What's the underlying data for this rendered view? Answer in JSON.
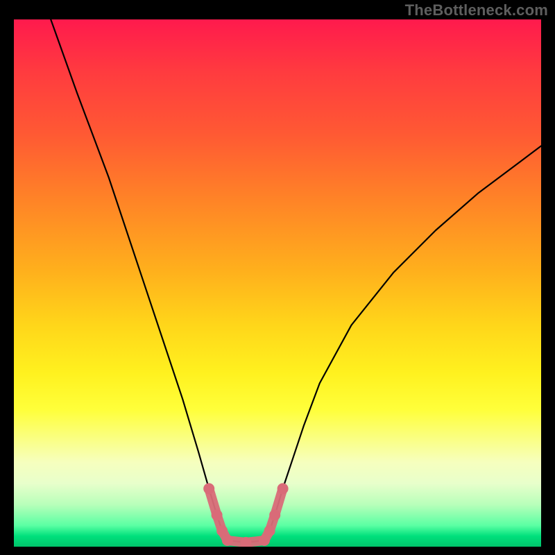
{
  "watermark": "TheBottleneck.com",
  "chart_data": {
    "type": "line",
    "title": "",
    "xlabel": "",
    "ylabel": "",
    "xlim": [
      0,
      100
    ],
    "ylim": [
      0,
      100
    ],
    "series": [
      {
        "name": "black-curve",
        "x": [
          7,
          12,
          18,
          24,
          28,
          32,
          35,
          37,
          38.5,
          39.5,
          40.5,
          44,
          47.5,
          48.5,
          49.5,
          51,
          53,
          55,
          58,
          64,
          72,
          80,
          88,
          96,
          100
        ],
        "y": [
          100,
          86,
          70,
          52,
          40,
          28,
          18,
          11,
          6,
          3,
          1.2,
          0.8,
          1.2,
          3,
          6,
          11,
          17,
          23,
          31,
          42,
          52,
          60,
          67,
          73,
          76
        ]
      },
      {
        "name": "pink-highlight",
        "x": [
          37,
          38.5,
          39.5,
          40.5,
          44,
          47.5,
          48.5,
          49.5,
          51
        ],
        "y": [
          11,
          6,
          3,
          1.2,
          0.8,
          1.2,
          3,
          6,
          11
        ]
      }
    ]
  }
}
